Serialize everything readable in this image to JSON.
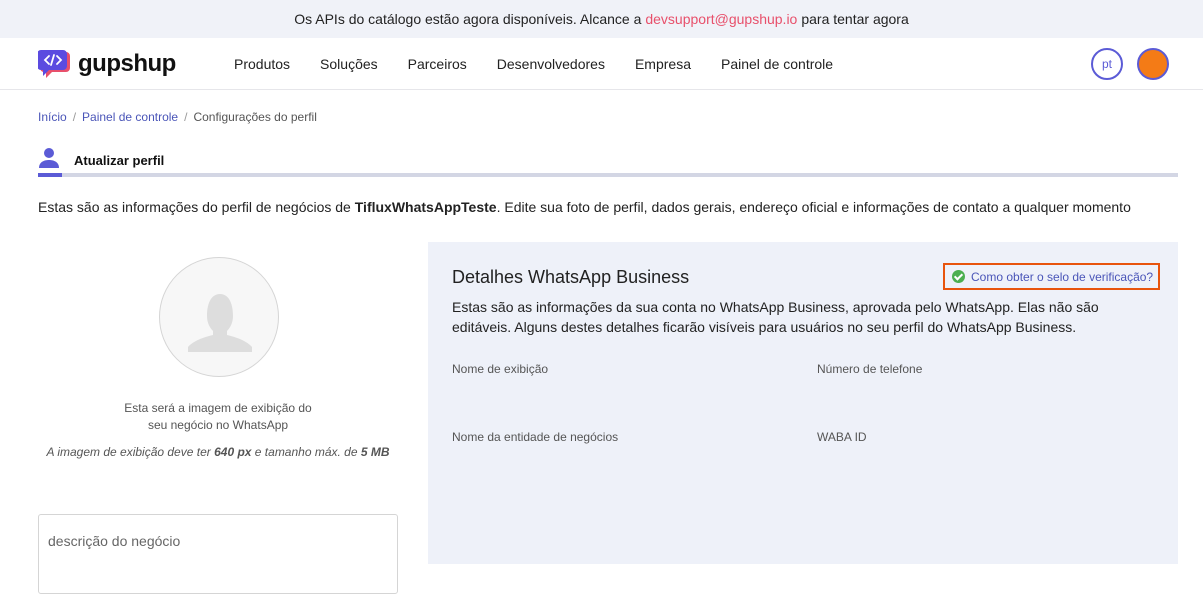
{
  "banner": {
    "text_before": "Os APIs do catálogo estão agora disponíveis. Alcance a",
    "email": "devsupport@gupshup.io",
    "text_after": "para tentar agora"
  },
  "brand": {
    "name": "gupshup"
  },
  "nav": {
    "items": [
      "Produtos",
      "Soluções",
      "Parceiros",
      "Desenvolvedores",
      "Empresa",
      "Painel de controle"
    ],
    "language": "pt",
    "accent_color": "#5b5bd6",
    "avatar_color": "#f47b16"
  },
  "breadcrumb": [
    "Início",
    "Painel de controle",
    "Configurações do perfil"
  ],
  "tab": {
    "label": "Atualizar perfil"
  },
  "intro": {
    "before": "Estas são as informações do perfil de negócios de",
    "business": "TifluxWhatsAppTeste",
    "after": ". Edite sua foto de perfil, dados gerais, endereço oficial e informações de contato a qualquer momento"
  },
  "profile_image": {
    "caption_line1": "Esta será a imagem de exibição do",
    "caption_line2": "seu negócio no WhatsApp",
    "note_before": "A imagem de exibição deve ter",
    "note_size": "640 px",
    "note_middle": "e tamanho máx. de",
    "note_max": "5 MB"
  },
  "description": {
    "placeholder": "descrição do negócio"
  },
  "whatsapp_panel": {
    "title": "Detalhes WhatsApp Business",
    "verify_link": "Como obter o selo de verificação?",
    "description": "Estas são as informações da sua conta no WhatsApp Business, aprovada pelo WhatsApp. Elas não são editáveis. Alguns destes detalhes ficarão visíveis para usuários no seu perfil do WhatsApp Business.",
    "fields": {
      "display_name": "Nome de exibição",
      "phone": "Número de telefone",
      "entity_name": "Nome da entidade de negócios",
      "waba_id": "WABA ID"
    },
    "highlight_color": "#e8540d"
  }
}
